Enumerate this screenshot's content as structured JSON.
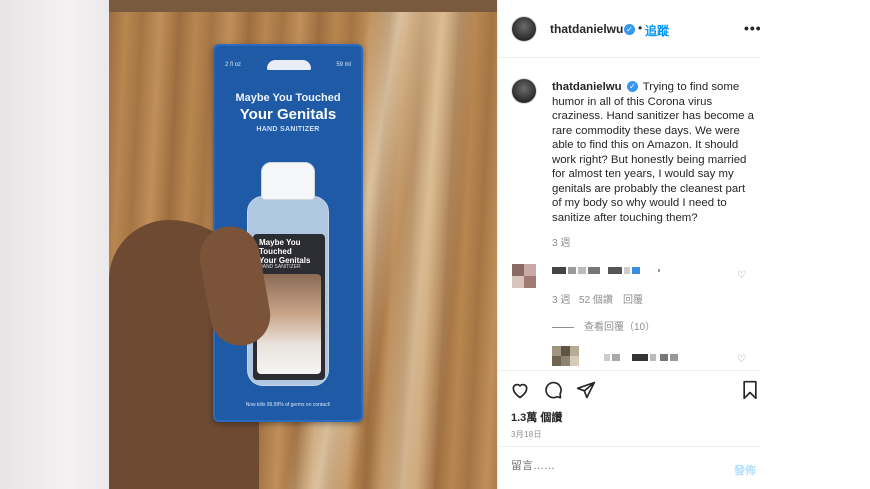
{
  "post": {
    "username": "thatdanielwu",
    "verified_mark": "✓",
    "separator": "•",
    "follow_label": "追蹤",
    "more_label": "•••",
    "caption": "Trying to find some humor in all of this Corona virus craziness. Hand sanitizer has become a rare commodity these days. We were able to find this on Amazon. It should work right? But honestly being married for almost ten years, I would say my genitals are probably the cleanest part of my body so why would I need to sanitize after touching them?",
    "caption_time": "3 週"
  },
  "product_card": {
    "size_left": "2 fl oz",
    "size_right": "59 ml",
    "line1": "Maybe You Touched",
    "line2": "Your Genitals",
    "line3": "HAND SANITIZER",
    "label_line1": "Maybe You",
    "label_line2": "Touched",
    "label_line3": "Your Genitals",
    "label_line4": "HAND SANITIZER",
    "footer": "Now kills 99.99% of germs on contact!"
  },
  "comments": [
    {
      "time": "3 週",
      "likes": "52 個讚",
      "reply_label": "回覆",
      "heart": "♡"
    },
    {
      "heart": "♡"
    }
  ],
  "view_replies": "查看回覆（10）",
  "actions": {
    "like_icon": "heart-icon",
    "comment_icon": "comment-icon",
    "share_icon": "share-icon",
    "save_icon": "bookmark-icon"
  },
  "likes_count": "1.3萬 個讚",
  "post_date": "3月18日",
  "comment_box": {
    "placeholder": "留言……",
    "post_label": "發佈"
  },
  "colors": {
    "accent": "#0095f6",
    "verified": "#3897f0",
    "post_disabled": "#b2dffc",
    "card_blue": "#1e5aa6"
  }
}
